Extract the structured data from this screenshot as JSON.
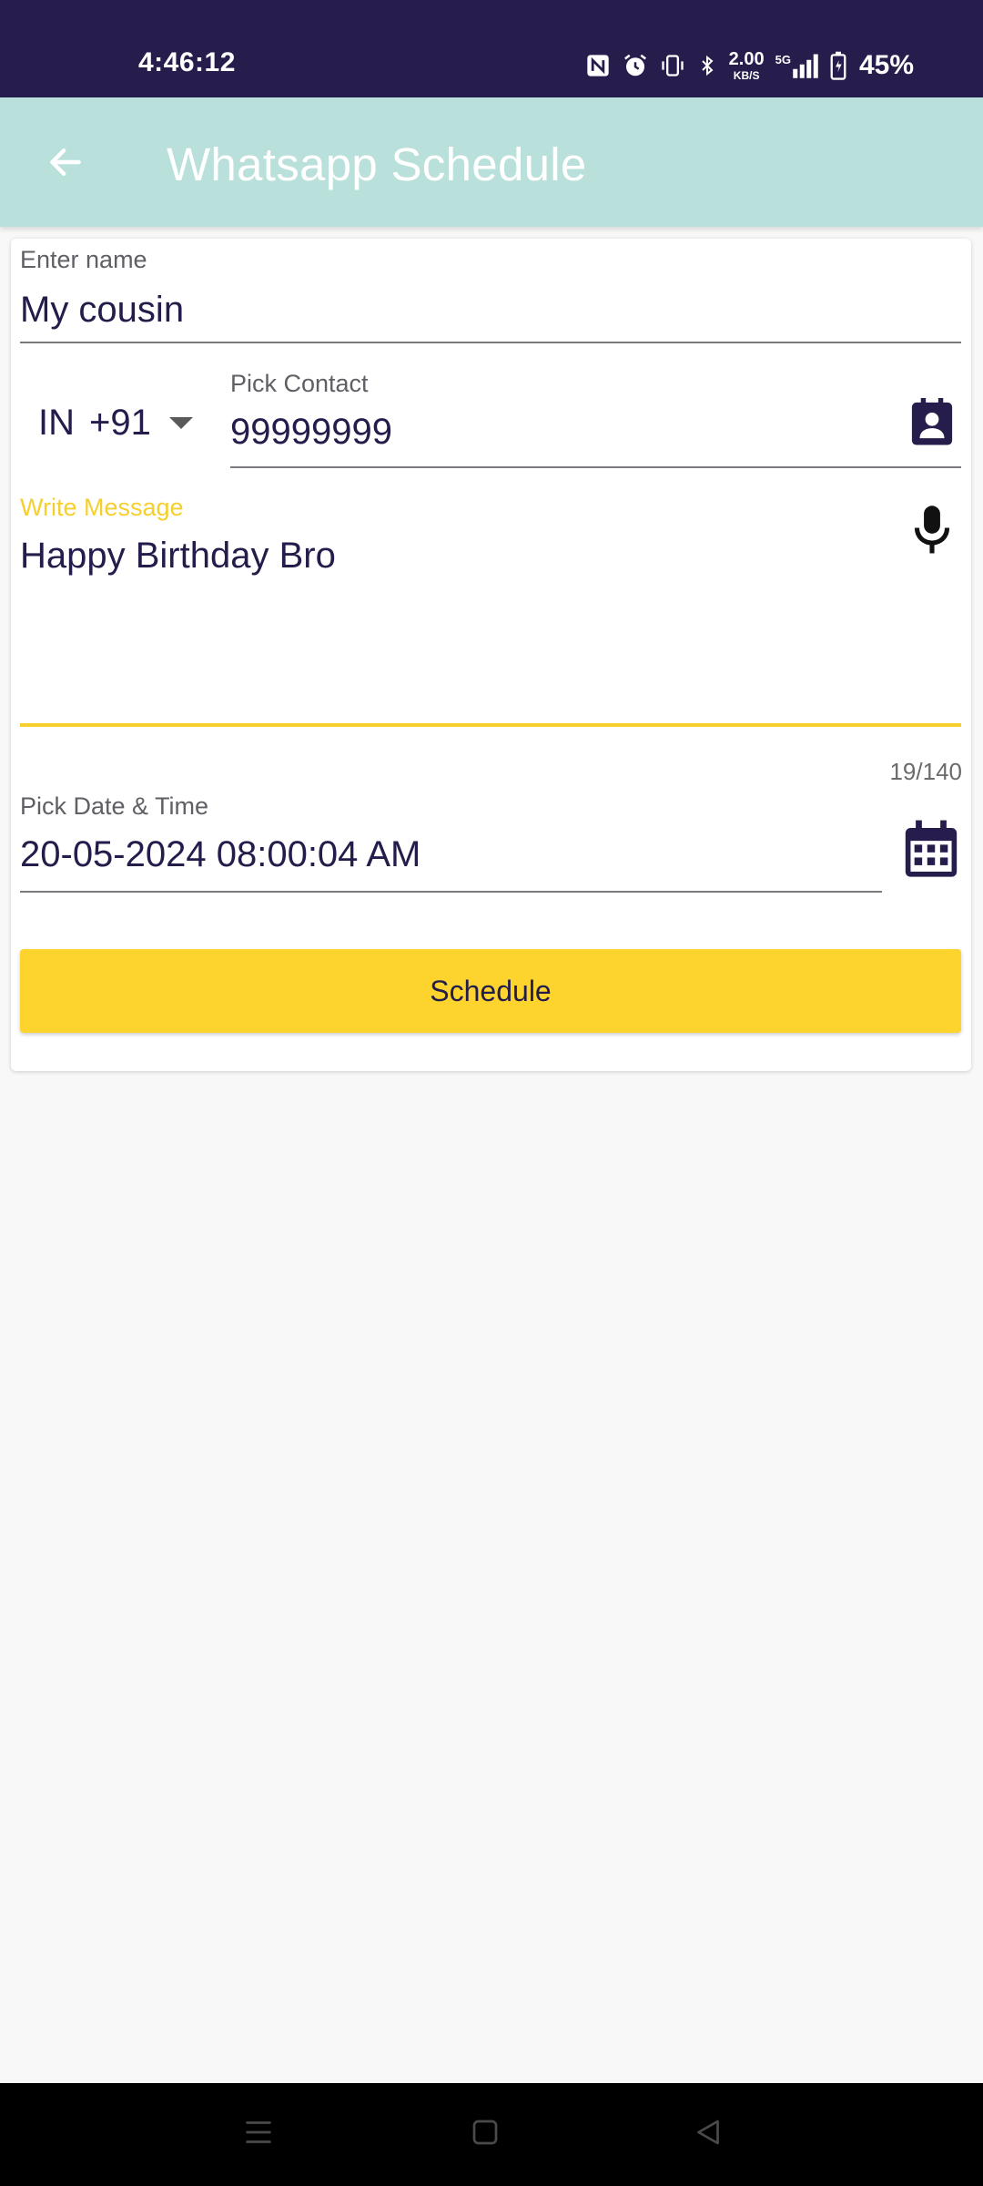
{
  "status_bar": {
    "time": "4:46:12",
    "net_speed_value": "2.00",
    "net_speed_unit": "KB/S",
    "network_label": "5G",
    "battery": "45%",
    "icons": [
      "nfc-icon",
      "alarm-icon",
      "vibrate-icon",
      "bluetooth-icon",
      "signal-icon",
      "battery-icon"
    ]
  },
  "app_bar": {
    "title": "Whatsapp Schedule"
  },
  "form": {
    "name_label": "Enter name",
    "name_value": "My cousin",
    "country_code": "IN",
    "dial_code": "+91",
    "contact_label": "Pick Contact",
    "contact_value": "99999999",
    "message_label": "Write Message",
    "message_value": "Happy Birthday Bro",
    "counter": "19/140",
    "datetime_label": "Pick Date & Time",
    "datetime_value": "20-05-2024 08:00:04 AM",
    "schedule_label": "Schedule"
  },
  "colors": {
    "status_bar": "#271d4c",
    "app_bar": "#b9e0da",
    "accent": "#fdd32e",
    "text": "#221d4a"
  }
}
